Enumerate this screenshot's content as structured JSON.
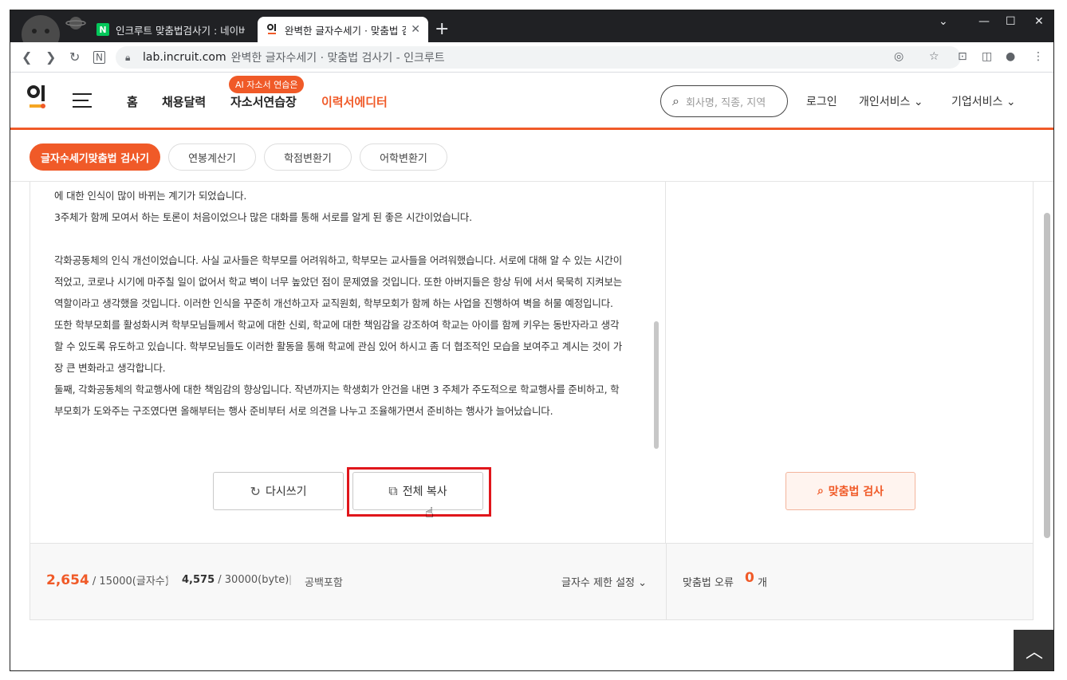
{
  "browser": {
    "tabs": [
      {
        "label": "인크루트 맞춤법검사기 : 네이버",
        "favicon": "N"
      },
      {
        "label": "완벽한 글자수세기 · 맞춤법 검사",
        "favicon": "인"
      }
    ],
    "new_tab": "+",
    "window_controls": [
      "⌄",
      "—",
      "☐",
      "✕"
    ],
    "address": {
      "host": "lab.incruit.com",
      "title": "완벽한 글자수세기 · 맞춤법 검사기 - 인크루트"
    }
  },
  "header": {
    "logo": "인",
    "nav": [
      "홈",
      "채용달력",
      "자소서연습장",
      "이력서에디터"
    ],
    "ai_badge": "AI 자소서 연습은",
    "search_placeholder": "회사명, 직종, 지역",
    "links": [
      "로그인",
      "개인서비스",
      "기업서비스"
    ]
  },
  "subnav": [
    "글자수세기맞춤법 검사기",
    "연봉계산기",
    "학점변환기",
    "어학변환기"
  ],
  "editor": {
    "lines": [
      "에 대한 인식이 많이 바뀌는 계기가 되었습니다.",
      "3주체가 함께 모여서 하는 토론이 처음이었으나 많은 대화를 통해 서로를 알게 된 좋은 시간이었습니다.",
      "",
      "각화공동체의 인식 개선이었습니다. 사실 교사들은 학부모를 어려워하고, 학부모는 교사들을 어려워했습니다. 서로에 대해 알 수 있는 시간이",
      "적었고, 코로나 시기에 마주칠 일이 없어서 학교 벽이 너무 높았던 점이 문제였을 것입니다. 또한 아버지들은 항상 뒤에 서서 묵묵히 지켜보는",
      "역할이라고 생각했을 것입니다. 이러한 인식을 꾸준히 개선하고자 교직원회, 학부모회가 함께 하는 사업을 진행하여 벽을 허물 예정입니다.",
      "또한 학부모회를 활성화시켜 학부모님들께서 학교에 대한 신뢰, 학교에 대한 책임감을 강조하여 학교는 아이를 함께 키우는 동반자라고 생각",
      "할 수 있도록 유도하고 있습니다. 학부모님들도 이러한 활동을 통해 학교에 관심 있어 하시고 좀 더 협조적인 모습을 보여주고 계시는 것이 가",
      "장 큰 변화라고 생각합니다.",
      " 둘째, 각화공동체의 학교행사에 대한 책임감의 향상입니다. 작년까지는 학생회가 안건을 내면 3 주체가 주도적으로 학교행사를 준비하고, 학",
      "부모회가 도와주는 구조였다면 올해부터는 행사 준비부터 서로 의견을 나누고 조율해가면서 준비하는 행사가 늘어났습니다."
    ]
  },
  "buttons": {
    "rewrite": "다시쓰기",
    "copy_all": "전체 복사",
    "spell_check": "맞춤법 검사"
  },
  "stats": {
    "char_count": "2,654",
    "char_limit": "/ 15000(글자수)",
    "byte_count": "4,575",
    "byte_limit": "/ 30000(byte)",
    "space_note": "공백포함",
    "limit_setting": "글자수 제한 설정",
    "spell_error_label": "맞춤법 오류",
    "spell_error_count": "0",
    "spell_error_unit": "개"
  },
  "colors": {
    "accent": "#f05a28",
    "highlight": "#e0161b"
  }
}
